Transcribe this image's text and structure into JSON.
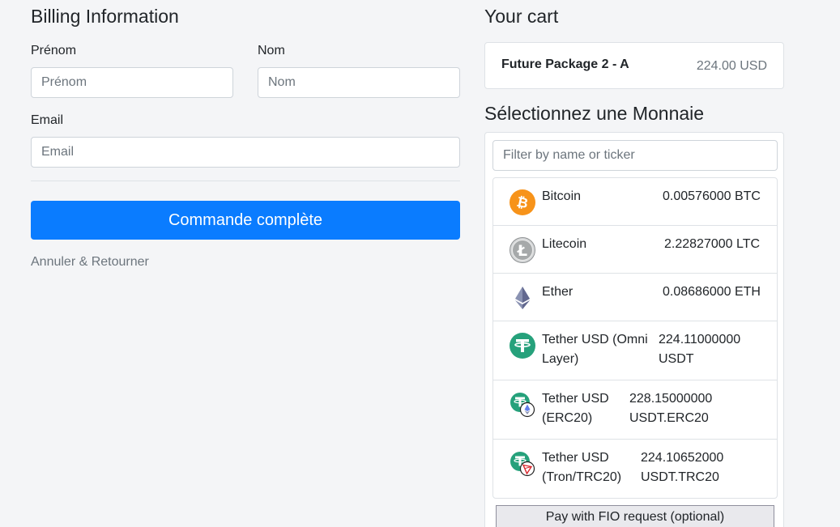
{
  "billing": {
    "title": "Billing Information",
    "first_name_label": "Prénom",
    "first_name_placeholder": "Prénom",
    "first_name_value": "",
    "last_name_label": "Nom",
    "last_name_placeholder": "Nom",
    "last_name_value": "",
    "email_label": "Email",
    "email_placeholder": "Email",
    "email_value": "",
    "submit_label": "Commande complète",
    "cancel_label": "Annuler & Retourner"
  },
  "cart": {
    "title": "Your cart",
    "item_name": "Future Package 2 - A",
    "item_price": "224.00 USD"
  },
  "currency": {
    "title": "Sélectionnez une Monnaie",
    "filter_placeholder": "Filter by name or ticker",
    "coins": [
      {
        "name": "Bitcoin",
        "amount": "0.00576000 BTC",
        "icon": "bitcoin-icon"
      },
      {
        "name": "Litecoin",
        "amount": "2.22827000 LTC",
        "icon": "litecoin-icon"
      },
      {
        "name": "Ether",
        "amount": "0.08686000 ETH",
        "icon": "ether-icon"
      },
      {
        "name_line1": "Tether USD (Omni",
        "name_line2": "Layer)",
        "amount_line1": "224.11000000",
        "amount_line2": "USDT",
        "icon": "tether-icon"
      },
      {
        "name_line1": "Tether USD",
        "name_line2": "(ERC20)",
        "amount_line1": "228.15000000",
        "amount_line2": "USDT.ERC20",
        "icon": "tether-erc20-icon"
      },
      {
        "name_line1": "Tether USD",
        "name_line2": "(Tron/TRC20)",
        "amount_line1": "224.10652000",
        "amount_line2": "USDT.TRC20",
        "icon": "tether-trc20-icon"
      }
    ],
    "fio_label": "Pay with FIO request (optional)"
  },
  "colors": {
    "primary": "#0a7cff",
    "bitcoin": "#f7931a",
    "tether": "#26a17b",
    "litecoin": "#a6a9aa",
    "ether": "#627eea"
  }
}
